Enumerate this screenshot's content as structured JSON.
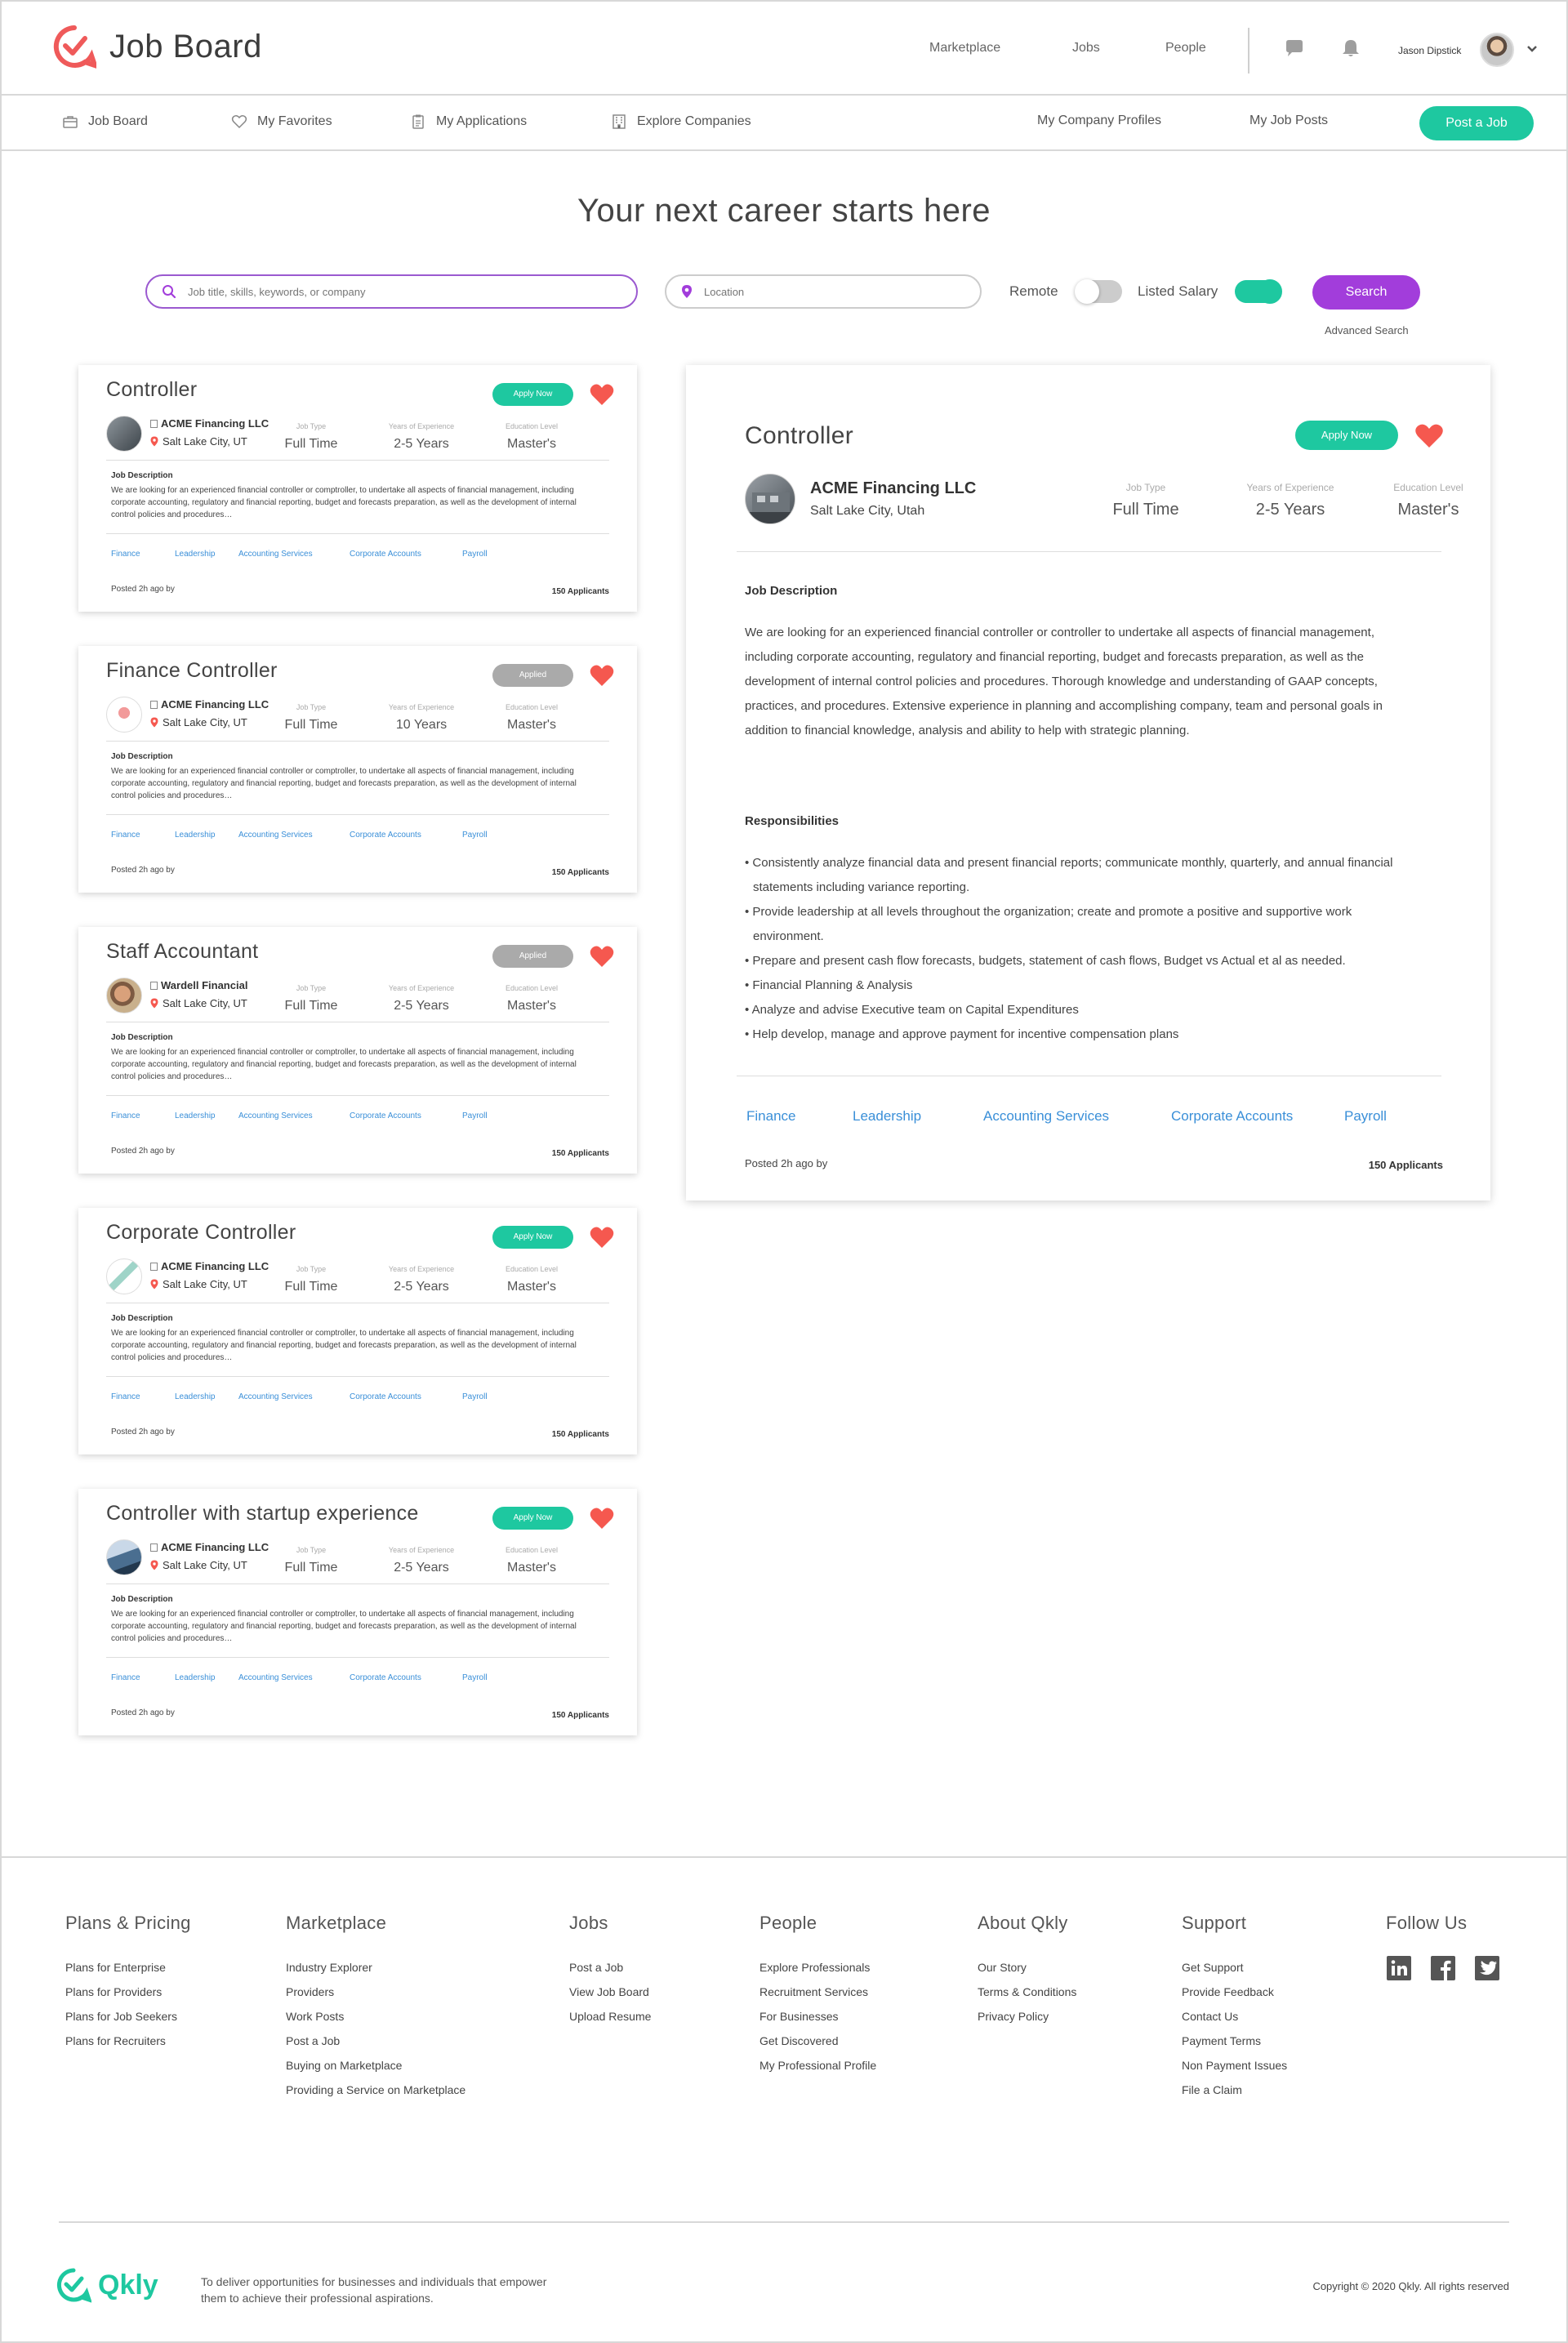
{
  "brand": {
    "name": "Job Board",
    "accent": "#1ec8a0",
    "logo_color": "#ef5a5a",
    "search_color": "#a23ddb"
  },
  "topnav": {
    "items": [
      "Marketplace",
      "Jobs",
      "People"
    ],
    "username": "Jason Dipstick"
  },
  "subnav": {
    "left": [
      {
        "label": "Job Board",
        "icon": "briefcase-icon"
      },
      {
        "label": "My Favorites",
        "icon": "heart-outline-icon"
      },
      {
        "label": "My Applications",
        "icon": "clipboard-icon"
      },
      {
        "label": "Explore Companies",
        "icon": "building-icon"
      }
    ],
    "right": [
      "My Company Profiles",
      "My Job Posts"
    ],
    "post_button": "Post a Job"
  },
  "hero": {
    "title": "Your next career starts here",
    "search_placeholder": "Job title, skills, keywords, or company",
    "location_placeholder": "Location",
    "remote_label": "Remote",
    "remote_on": false,
    "salary_label": "Listed Salary",
    "salary_on": true,
    "search_button": "Search",
    "advanced_search": "Advanced Search"
  },
  "labels": {
    "job_type": "Job Type",
    "years": "Years of Experience",
    "education": "Education Level",
    "job_description": "Job Description",
    "responsibilities": "Responsibilities",
    "posted": "Posted 2h ago by",
    "applicants": "150 Applicants"
  },
  "tags": [
    "Finance",
    "Leadership",
    "Accounting Services",
    "Corporate Accounts",
    "Payroll"
  ],
  "card_description": "We are looking for an experienced financial controller or comptroller, to undertake all aspects of financial management, including corporate accounting, regulatory and financial reporting, budget and forecasts preparation, as well as the development of internal control policies and procedures…",
  "jobs": [
    {
      "title": "Controller",
      "status": "Apply Now",
      "company": "ACME Financing LLC",
      "location": "Salt Lake City, UT",
      "job_type": "Full Time",
      "years": "2-5 Years",
      "education": "Master's"
    },
    {
      "title": "Finance Controller",
      "status": "Applied",
      "company": "ACME Financing LLC",
      "location": "Salt Lake City, UT",
      "job_type": "Full Time",
      "years": "10 Years",
      "education": "Master's"
    },
    {
      "title": "Staff Accountant",
      "status": "Applied",
      "company": "Wardell Financial",
      "location": "Salt Lake City, UT",
      "job_type": "Full Time",
      "years": "2-5 Years",
      "education": "Master's"
    },
    {
      "title": "Corporate Controller",
      "status": "Apply Now",
      "company": "ACME Financing LLC",
      "location": "Salt Lake City, UT",
      "job_type": "Full Time",
      "years": "2-5 Years",
      "education": "Master's"
    },
    {
      "title": "Controller with startup experience",
      "status": "Apply Now",
      "company": "ACME Financing LLC",
      "location": "Salt Lake City, UT",
      "job_type": "Full Time",
      "years": "2-5 Years",
      "education": "Master's"
    }
  ],
  "detail": {
    "title": "Controller",
    "apply": "Apply Now",
    "company": "ACME Financing LLC",
    "location": "Salt Lake City, Utah",
    "job_type": "Full Time",
    "years": "2-5 Years",
    "education": "Master's",
    "description": "We are looking for an experienced financial controller or controller to undertake all aspects of financial management, including corporate accounting, regulatory and financial reporting, budget and forecasts preparation, as well as the development of internal control policies and procedures. Thorough knowledge and understanding of GAAP concepts, practices, and procedures. Extensive experience in planning and accomplishing company, team and personal goals in addition to financial knowledge, analysis and ability to help with strategic planning.",
    "responsibilities": [
      "• Consistently analyze financial data and present financial reports; communicate monthly, quarterly, and annual financial statements including variance reporting.",
      "• Provide leadership at all levels throughout the organization; create and promote a positive and supportive work environment.",
      "• Prepare and present cash flow forecasts, budgets, statement of cash flows, Budget vs Actual et al as needed.",
      "• Financial Planning & Analysis",
      "• Analyze and advise Executive team on Capital Expenditures",
      "• Help develop, manage and approve payment for incentive compensation plans"
    ]
  },
  "footer": {
    "columns": [
      {
        "heading": "Plans & Pricing",
        "links": [
          "Plans for Enterprise",
          "Plans for Providers",
          "Plans for Job Seekers",
          "Plans for Recruiters"
        ]
      },
      {
        "heading": "Marketplace",
        "links": [
          "Industry Explorer",
          "Providers",
          "Work Posts",
          "Post a Job",
          "Buying on Marketplace",
          "Providing a Service on Marketplace"
        ]
      },
      {
        "heading": "Jobs",
        "links": [
          "Post a Job",
          "View Job Board",
          "Upload Resume"
        ]
      },
      {
        "heading": "People",
        "links": [
          "Explore Professionals",
          "Recruitment Services",
          "For Businesses",
          "Get Discovered",
          "My Professional Profile"
        ]
      },
      {
        "heading": "About Qkly",
        "links": [
          "Our Story",
          "Terms & Conditions",
          "Privacy Policy"
        ]
      },
      {
        "heading": "Support",
        "links": [
          "Get Support",
          "Provide Feedback",
          "Contact Us",
          "Payment Terms",
          "Non Payment Issues",
          "File a Claim"
        ]
      }
    ],
    "follow": "Follow Us",
    "social": [
      "linkedin-icon",
      "facebook-icon",
      "twitter-icon"
    ],
    "brand": "Qkly",
    "tagline": "To deliver opportunities for businesses and individuals that empower them to achieve their professional aspirations.",
    "copyright": "Copyright © 2020 Qkly. All rights reserved"
  }
}
